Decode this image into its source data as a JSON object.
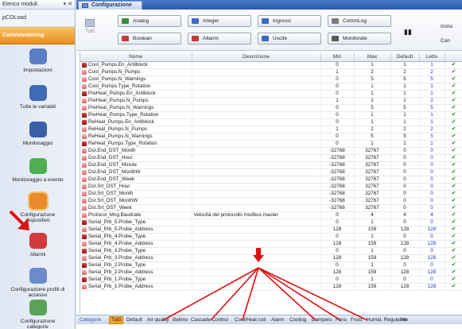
{
  "left_panel": {
    "header_title": "Elenco moduli",
    "header_controls": "▾ ✕",
    "module_pcoload": "pCOLoad",
    "commissioning": "Commissioning",
    "nav_items": [
      {
        "label": "Impostazioni",
        "icon": "wrench-icon",
        "color": "#5b7fc4"
      },
      {
        "label": "Tutte le variabili",
        "icon": "variables-icon",
        "color": "#3f6ab8"
      },
      {
        "label": "Monitoraggio",
        "icon": "monitor-icon",
        "color": "#3b5ea8"
      },
      {
        "label": "Monitoraggio a evento",
        "icon": "event-monitor-icon",
        "color": "#4fae4f"
      },
      {
        "label": "Configurazione dispositivo",
        "icon": "device-config-icon",
        "color": "#e98b2a"
      },
      {
        "label": "Allarmi",
        "icon": "alarm-icon",
        "color": "#d23b3b"
      },
      {
        "label": "Configurazione profili di accesso",
        "icon": "user-profiles-icon",
        "color": "#6b8ccc"
      },
      {
        "label": "Configurazione categorie",
        "icon": "categories-icon",
        "color": "#5aa25a"
      }
    ]
  },
  "tab": {
    "label": "Configurazione"
  },
  "toolbar": {
    "tutti_label": "Tutti",
    "buttons": [
      {
        "label": "Analog",
        "icon": "analog-icon",
        "color": "#3a8f3a"
      },
      {
        "label": "Integer",
        "icon": "integer-icon",
        "color": "#3b6bc2"
      },
      {
        "label": "Ingressi",
        "icon": "inputs-icon",
        "color": "#3b6bc2"
      },
      {
        "label": "CommLog",
        "icon": "commlog-icon",
        "color": "#7a7a7a"
      },
      {
        "label": "Boolean",
        "icon": "boolean-icon",
        "color": "#c43a3a"
      },
      {
        "label": "Allarmi",
        "icon": "alarm-icon",
        "color": "#c43a3a"
      },
      {
        "label": "Uscite",
        "icon": "outputs-icon",
        "color": "#3b6bc2"
      },
      {
        "label": "Monitorate",
        "icon": "monitored-icon",
        "color": "#5a5a5a"
      }
    ],
    "binoculars": "🔍",
    "inizio": "Inizio",
    "con": "Con"
  },
  "table": {
    "headers": [
      "Nome",
      "Descrizione",
      "Min",
      "Max",
      "Default",
      "Letto",
      ""
    ],
    "rows": [
      {
        "name": "Cool_Pumps.En_Antiblock",
        "desc": "",
        "min": "0",
        "max": "1",
        "def": "1",
        "letto": "1",
        "rw": true
      },
      {
        "name": "Cool_Pumps.N_Pumps",
        "desc": "",
        "min": "1",
        "max": "2",
        "def": "2",
        "letto": "2",
        "rw": false
      },
      {
        "name": "Cool_Pumps.N_Warnings",
        "desc": "",
        "min": "0",
        "max": "5",
        "def": "5",
        "letto": "5",
        "rw": false
      },
      {
        "name": "Cool_Pumps.Type_Rotation",
        "desc": "",
        "min": "0",
        "max": "1",
        "def": "1",
        "letto": "1",
        "rw": false
      },
      {
        "name": "PreHeat_Pumps.En_Antiblock",
        "desc": "",
        "min": "0",
        "max": "1",
        "def": "1",
        "letto": "1",
        "rw": true
      },
      {
        "name": "PreHeat_Pumps.N_Pumps",
        "desc": "",
        "min": "1",
        "max": "2",
        "def": "2",
        "letto": "2",
        "rw": false
      },
      {
        "name": "PreHeat_Pumps.N_Warnings",
        "desc": "",
        "min": "0",
        "max": "5",
        "def": "5",
        "letto": "5",
        "rw": false
      },
      {
        "name": "PreHeat_Pumps.Type_Rotation",
        "desc": "",
        "min": "0",
        "max": "1",
        "def": "1",
        "letto": "1",
        "rw": true
      },
      {
        "name": "ReHeat_Pumps.En_Antiblock",
        "desc": "",
        "min": "0",
        "max": "1",
        "def": "1",
        "letto": "1",
        "rw": true
      },
      {
        "name": "ReHeat_Pumps.N_Pumps",
        "desc": "",
        "min": "1",
        "max": "2",
        "def": "2",
        "letto": "2",
        "rw": false
      },
      {
        "name": "ReHeat_Pumps.N_Warnings",
        "desc": "",
        "min": "0",
        "max": "5",
        "def": "5",
        "letto": "5",
        "rw": false
      },
      {
        "name": "ReHeat_Pumps.Type_Rotation",
        "desc": "",
        "min": "0",
        "max": "1",
        "def": "1",
        "letto": "1",
        "rw": true
      },
      {
        "name": "Dst.End_DST_Month",
        "desc": "",
        "min": "-32768",
        "max": "32767",
        "def": "0",
        "letto": "0",
        "rw": false
      },
      {
        "name": "Dst.End_DST_Hour",
        "desc": "",
        "min": "-32768",
        "max": "32767",
        "def": "0",
        "letto": "0",
        "rw": false
      },
      {
        "name": "Dst.End_DST_Minute",
        "desc": "",
        "min": "-32768",
        "max": "32767",
        "def": "0",
        "letto": "0",
        "rw": false
      },
      {
        "name": "Dst.End_DST_MonthW",
        "desc": "",
        "min": "-32768",
        "max": "32767",
        "def": "0",
        "letto": "0",
        "rw": false
      },
      {
        "name": "Dst.End_DST_Week",
        "desc": "",
        "min": "-32768",
        "max": "32767",
        "def": "0",
        "letto": "0",
        "rw": false
      },
      {
        "name": "Dst.Srt_DST_Hour",
        "desc": "",
        "min": "-32768",
        "max": "32767",
        "def": "0",
        "letto": "0",
        "rw": false
      },
      {
        "name": "Dst.Srt_DST_Month",
        "desc": "",
        "min": "-32768",
        "max": "32767",
        "def": "0",
        "letto": "0",
        "rw": false
      },
      {
        "name": "Dst.Srt_DST_MonthW",
        "desc": "",
        "min": "-32768",
        "max": "32767",
        "def": "0",
        "letto": "0",
        "rw": false
      },
      {
        "name": "Dst.Srt_DST_Week",
        "desc": "",
        "min": "-32768",
        "max": "32767",
        "def": "0",
        "letto": "0",
        "rw": false
      },
      {
        "name": "Protocol_Mng.Baudrate",
        "desc": "Velocità del protocollo modbus master",
        "min": "0",
        "max": "4",
        "def": "4",
        "letto": "4",
        "rw": false
      },
      {
        "name": "Serial_Prb_5.Probe_Type",
        "desc": "",
        "min": "0",
        "max": "1",
        "def": "0",
        "letto": "0",
        "rw": true
      },
      {
        "name": "Serial_Prb_5.Probe_Address",
        "desc": "",
        "min": "128",
        "max": "159",
        "def": "128",
        "letto": "128",
        "rw": false
      },
      {
        "name": "Serial_Prb_4.Probe_Type",
        "desc": "",
        "min": "0",
        "max": "1",
        "def": "0",
        "letto": "0",
        "rw": true
      },
      {
        "name": "Serial_Prb_4.Probe_Address",
        "desc": "",
        "min": "128",
        "max": "159",
        "def": "128",
        "letto": "128",
        "rw": false
      },
      {
        "name": "Serial_Prb_3.Probe_Type",
        "desc": "",
        "min": "0",
        "max": "1",
        "def": "0",
        "letto": "0",
        "rw": true
      },
      {
        "name": "Serial_Prb_3.Probe_Address",
        "desc": "",
        "min": "128",
        "max": "159",
        "def": "128",
        "letto": "128",
        "rw": false
      },
      {
        "name": "Serial_Prb_2.Probe_Type",
        "desc": "",
        "min": "0",
        "max": "1",
        "def": "0",
        "letto": "0",
        "rw": true
      },
      {
        "name": "Serial_Prb_2.Probe_Address",
        "desc": "",
        "min": "128",
        "max": "159",
        "def": "128",
        "letto": "128",
        "rw": false
      },
      {
        "name": "Serial_Prb_1.Probe_Type",
        "desc": "",
        "min": "0",
        "max": "1",
        "def": "0",
        "letto": "0",
        "rw": true
      },
      {
        "name": "Serial_Prb_1.Probe_Address",
        "desc": "",
        "min": "128",
        "max": "159",
        "def": "128",
        "letto": "128",
        "rw": false
      }
    ],
    "ok_glyph": "✔"
  },
  "categories": {
    "items": [
      "Categorie",
      "Tutti",
      "Default",
      "Air quality",
      "Belimo",
      "Cascade Control",
      "Cool/Heat coil",
      "Alarm",
      "Cooling",
      "Dampers",
      "Fans",
      "Frost",
      "Humid. Regulation",
      "Hu"
    ],
    "active_index": 1
  },
  "colors": {
    "accent_orange": "#f5a623",
    "header_blue": "#2c5aa6",
    "annotation_red": "#e01010"
  }
}
